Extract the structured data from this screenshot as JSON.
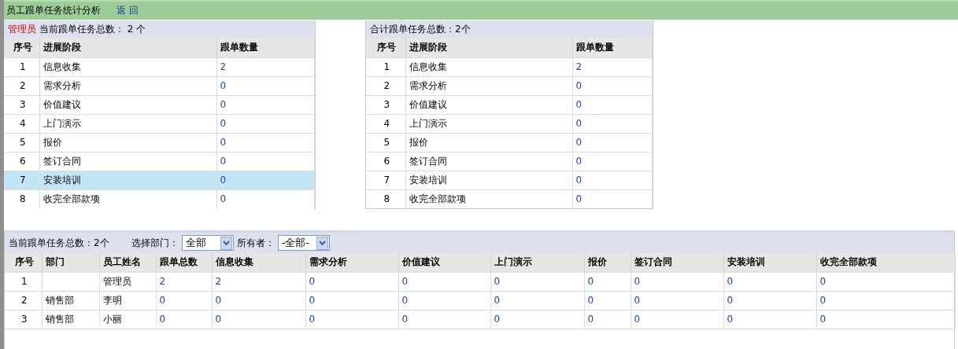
{
  "header": {
    "title": "员工跟单任务统计分析",
    "back_link": "返 回"
  },
  "user_table": {
    "user": "管理员",
    "summary": "当前跟单任务总数： 2 个",
    "columns": [
      "序号",
      "进展阶段",
      "跟单数量"
    ],
    "rows": [
      {
        "no": "1",
        "stage": "信息收集",
        "count": "2",
        "selected": false
      },
      {
        "no": "2",
        "stage": "需求分析",
        "count": "0",
        "selected": false
      },
      {
        "no": "3",
        "stage": "价值建议",
        "count": "0",
        "selected": false
      },
      {
        "no": "4",
        "stage": "上门演示",
        "count": "0",
        "selected": false
      },
      {
        "no": "5",
        "stage": "报价",
        "count": "0",
        "selected": false
      },
      {
        "no": "6",
        "stage": "签订合同",
        "count": "0",
        "selected": false
      },
      {
        "no": "7",
        "stage": "安装培训",
        "count": "0",
        "selected": true
      },
      {
        "no": "8",
        "stage": "收完全部款项",
        "count": "0",
        "selected": false
      }
    ]
  },
  "total_table": {
    "summary": "合计跟单任务总数：2个",
    "columns": [
      "序号",
      "进展阶段",
      "跟单数量"
    ],
    "rows": [
      {
        "no": "1",
        "stage": "信息收集",
        "count": "2",
        "selected": false
      },
      {
        "no": "2",
        "stage": "需求分析",
        "count": "0",
        "selected": false
      },
      {
        "no": "3",
        "stage": "价值建议",
        "count": "0",
        "selected": false
      },
      {
        "no": "4",
        "stage": "上门演示",
        "count": "0",
        "selected": false
      },
      {
        "no": "5",
        "stage": "报价",
        "count": "0",
        "selected": false
      },
      {
        "no": "6",
        "stage": "签订合同",
        "count": "0",
        "selected": false
      },
      {
        "no": "7",
        "stage": "安装培训",
        "count": "0",
        "selected": false
      },
      {
        "no": "8",
        "stage": "收完全部款项",
        "count": "0",
        "selected": false
      }
    ]
  },
  "staff_table": {
    "summary": "当前跟单任务总数：2个",
    "department_label": "选择部门：",
    "department_value": "全部",
    "owner_label": "所有者：",
    "owner_value": "-全部-",
    "columns": [
      "序号",
      "部门",
      "员工姓名",
      "跟单总数",
      "信息收集",
      "需求分析",
      "价值建议",
      "上门演示",
      "报价",
      "签订合同",
      "安装培训",
      "收完全部款项"
    ],
    "rows": [
      {
        "no": "1",
        "department": "",
        "name": "管理员",
        "values": [
          "2",
          "2",
          "0",
          "0",
          "0",
          "0",
          "0",
          "0",
          "0"
        ]
      },
      {
        "no": "2",
        "department": "销售部",
        "name": "李明",
        "values": [
          "0",
          "0",
          "0",
          "0",
          "0",
          "0",
          "0",
          "0",
          "0"
        ]
      },
      {
        "no": "3",
        "department": "销售部",
        "name": "小丽",
        "values": [
          "0",
          "0",
          "0",
          "0",
          "0",
          "0",
          "0",
          "0",
          "0"
        ]
      }
    ]
  }
}
